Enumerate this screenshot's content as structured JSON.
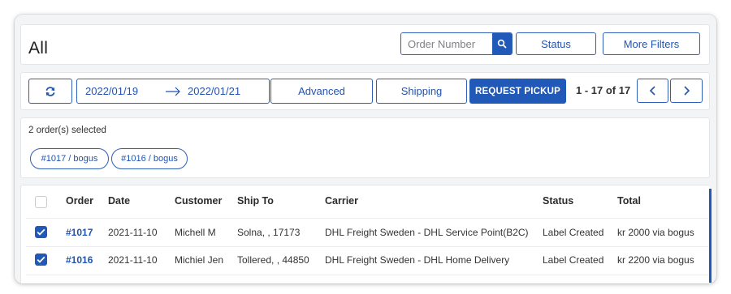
{
  "header": {
    "title": "All",
    "search_placeholder": "Order Number",
    "status_label": "Status",
    "more_filters_label": "More Filters"
  },
  "toolbar": {
    "date_from": "2022/01/19",
    "date_to": "2022/01/21",
    "advanced_label": "Advanced",
    "shipping_label": "Shipping",
    "request_pickup_label": "REQUEST PICKUP",
    "pagination": "1 - 17 of 17"
  },
  "selection": {
    "count_text": "2 order(s) selected",
    "chips": [
      "#1017 / bogus",
      "#1016 / bogus"
    ]
  },
  "table": {
    "columns": [
      "Order",
      "Date",
      "Customer",
      "Ship To",
      "Carrier",
      "Status",
      "Total"
    ],
    "rows": [
      {
        "checked": true,
        "order": "#1017",
        "date": "2021-11-10",
        "customer": "Michell M",
        "ship_to": "Solna, , 17173",
        "carrier": "DHL Freight Sweden - DHL Service Point(B2C)",
        "status": "Label Created",
        "total": "kr 2000 via bogus"
      },
      {
        "checked": true,
        "order": "#1016",
        "date": "2021-11-10",
        "customer": "Michiel Jen",
        "ship_to": "Tollered, , 44850",
        "carrier": "DHL Freight Sweden - DHL Home Delivery",
        "status": "Label Created",
        "total": "kr 2200 via bogus"
      }
    ]
  },
  "icons": {
    "search": "search-icon",
    "refresh": "refresh-icon",
    "arrow": "arrow-right-icon",
    "prev": "chevron-left-icon",
    "next": "chevron-right-icon",
    "check": "check-icon"
  },
  "colors": {
    "accent": "#2159b8",
    "link": "#2253b0",
    "background": "#f3f4f6"
  }
}
